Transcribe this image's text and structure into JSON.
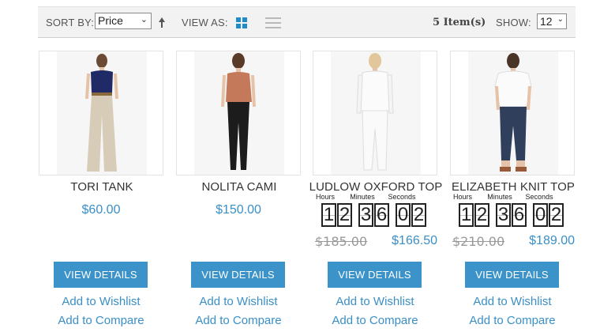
{
  "toolbar": {
    "sort_label": "SORT BY:",
    "sort_value": "Price",
    "view_label": "VIEW AS:",
    "item_count": "5 Item(s)",
    "show_label": "SHOW:",
    "show_value": "12"
  },
  "countdown_labels": {
    "hours": "Hours",
    "minutes": "Minutes",
    "seconds": "Seconds"
  },
  "products": [
    {
      "name": "TORI TANK",
      "price": "$60.00",
      "button": "VIEW DETAILS",
      "wishlist": "Add to Wishlist",
      "compare": "Add to Compare"
    },
    {
      "name": "NOLITA CAMI",
      "price": "$150.00",
      "button": "VIEW DETAILS",
      "wishlist": "Add to Wishlist",
      "compare": "Add to Compare"
    },
    {
      "name": "LUDLOW OXFORD TOP",
      "old_price": "$185.00",
      "price": "$166.50",
      "countdown": {
        "hours": [
          "1",
          "2"
        ],
        "minutes": [
          "3",
          "6"
        ],
        "seconds": [
          "0",
          "2"
        ]
      },
      "button": "VIEW DETAILS",
      "wishlist": "Add to Wishlist",
      "compare": "Add to Compare"
    },
    {
      "name": "ELIZABETH KNIT TOP",
      "old_price": "$210.00",
      "price": "$189.00",
      "countdown": {
        "hours": [
          "1",
          "2"
        ],
        "minutes": [
          "3",
          "6"
        ],
        "seconds": [
          "0",
          "2"
        ]
      },
      "button": "VIEW DETAILS",
      "wishlist": "Add to Wishlist",
      "compare": "Add to Compare"
    }
  ],
  "colors": {
    "accent": "#3c93c9",
    "link": "#3a8fc7",
    "toolbar_bg": "#f2f2f2",
    "old_price": "#999999"
  },
  "icons": {
    "sort_direction": "arrow-up-icon",
    "grid_view": "grid-icon",
    "list_view": "list-icon"
  }
}
